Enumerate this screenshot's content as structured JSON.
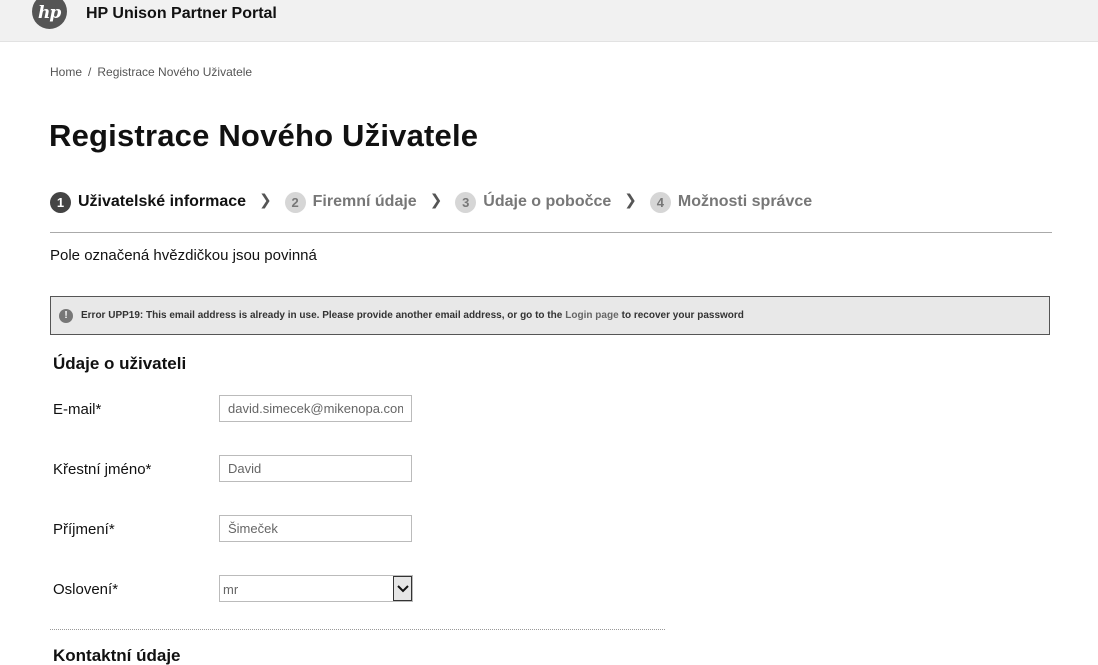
{
  "header": {
    "logo_text": "hp",
    "portal_title": "HP Unison Partner Portal"
  },
  "breadcrumb": {
    "home": "Home",
    "separator": "/",
    "current": "Registrace Nového Uživatele"
  },
  "page_title": "Registrace Nového Uživatele",
  "steps": [
    {
      "number": "1",
      "label": "Uživatelské informace",
      "active": true
    },
    {
      "number": "2",
      "label": "Firemní údaje",
      "active": false
    },
    {
      "number": "3",
      "label": "Údaje o pobočce",
      "active": false
    },
    {
      "number": "4",
      "label": "Možnosti správce",
      "active": false
    }
  ],
  "required_note": "Pole označená hvězdičkou jsou povinná",
  "error": {
    "icon": "exclamation-circle-icon",
    "text_before": "Error UPP19: This email address is already in use. Please provide another email address, or go to the",
    "link": "Login page",
    "text_after": "to recover your password"
  },
  "user_section": {
    "heading": "Údaje o uživateli",
    "email_label": "E-mail*",
    "email_value": "david.simecek@mikenopa.com",
    "first_name_label": "Křestní jméno*",
    "first_name_value": "David",
    "last_name_label": "Příjmení*",
    "last_name_value": "Šimeček",
    "salutation_label": "Oslovení*",
    "salutation_value": "mr"
  },
  "contact_section": {
    "heading": "Kontaktní údaje"
  },
  "colors": {
    "topbar": "#f1f1f1",
    "active_step": "#444444",
    "inactive_step": "#d6d6d6",
    "error_bg": "#e8e8e8"
  }
}
